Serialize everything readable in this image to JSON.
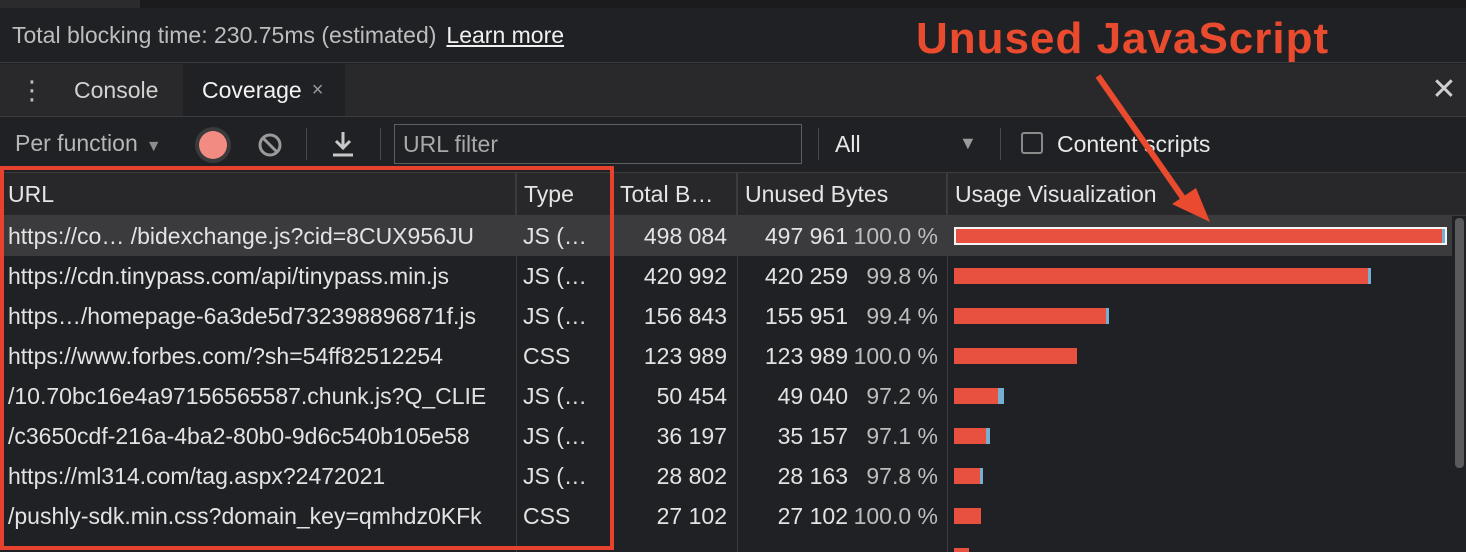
{
  "performance": {
    "tbt_text": "Total blocking time: 230.75ms (estimated)",
    "learn_more": "Learn more"
  },
  "tabs": {
    "console": "Console",
    "coverage": "Coverage",
    "close_glyph": "×"
  },
  "toolbar": {
    "mode": "Per function",
    "url_filter_placeholder": "URL filter",
    "type_filter": "All",
    "content_scripts": "Content scripts",
    "content_scripts_checked": false
  },
  "table": {
    "headers": {
      "url": "URL",
      "type": "Type",
      "total": "Total B…",
      "unused": "Unused Bytes",
      "vis": "Usage Visualization"
    },
    "rows": [
      {
        "url": "https://co… /bidexchange.js?cid=8CUX956JU",
        "type": "JS (…",
        "total": "498 084",
        "unused": "497 961",
        "pct": "100.0 %",
        "total_bytes": 498084,
        "unused_bytes": 497961,
        "selected": true
      },
      {
        "url": "https://cdn.tinypass.com/api/tinypass.min.js",
        "type": "JS (…",
        "total": "420 992",
        "unused": "420 259",
        "pct": "99.8 %",
        "total_bytes": 420992,
        "unused_bytes": 420259,
        "selected": false
      },
      {
        "url": "https…/homepage-6a3de5d732398896871f.js",
        "type": "JS (…",
        "total": "156 843",
        "unused": "155 951",
        "pct": "99.4 %",
        "total_bytes": 156843,
        "unused_bytes": 155951,
        "selected": false
      },
      {
        "url": "https://www.forbes.com/?sh=54ff82512254",
        "type": "CSS",
        "total": "123 989",
        "unused": "123 989",
        "pct": "100.0 %",
        "total_bytes": 123989,
        "unused_bytes": 123989,
        "selected": false
      },
      {
        "url": "/10.70bc16e4a97156565587.chunk.js?Q_CLIE",
        "type": "JS (…",
        "total": "50 454",
        "unused": "49 040",
        "pct": "97.2 %",
        "total_bytes": 50454,
        "unused_bytes": 49040,
        "selected": false
      },
      {
        "url": "/c3650cdf-216a-4ba2-80b0-9d6c540b105e58",
        "type": "JS (…",
        "total": "36 197",
        "unused": "35 157",
        "pct": "97.1 %",
        "total_bytes": 36197,
        "unused_bytes": 35157,
        "selected": false
      },
      {
        "url": "https://ml314.com/tag.aspx?2472021",
        "type": "JS (…",
        "total": "28 802",
        "unused": "28 163",
        "pct": "97.8 %",
        "total_bytes": 28802,
        "unused_bytes": 28163,
        "selected": false
      },
      {
        "url": "/pushly-sdk.min.css?domain_key=qmhdz0KFk",
        "type": "CSS",
        "total": "27 102",
        "unused": "27 102",
        "pct": "100.0 %",
        "total_bytes": 27102,
        "unused_bytes": 27102,
        "selected": false
      },
      {
        "url": "",
        "type": "",
        "total": "",
        "unused": "",
        "pct": "",
        "total_bytes": 15335,
        "unused_bytes": 15335,
        "selected": false
      }
    ]
  },
  "annotation": {
    "label": "Unused JavaScript",
    "color": "#ea4a2d"
  },
  "colors": {
    "unused_bar": "#e8513f",
    "used_bar": "#78aed0",
    "record": "#f28b82"
  }
}
